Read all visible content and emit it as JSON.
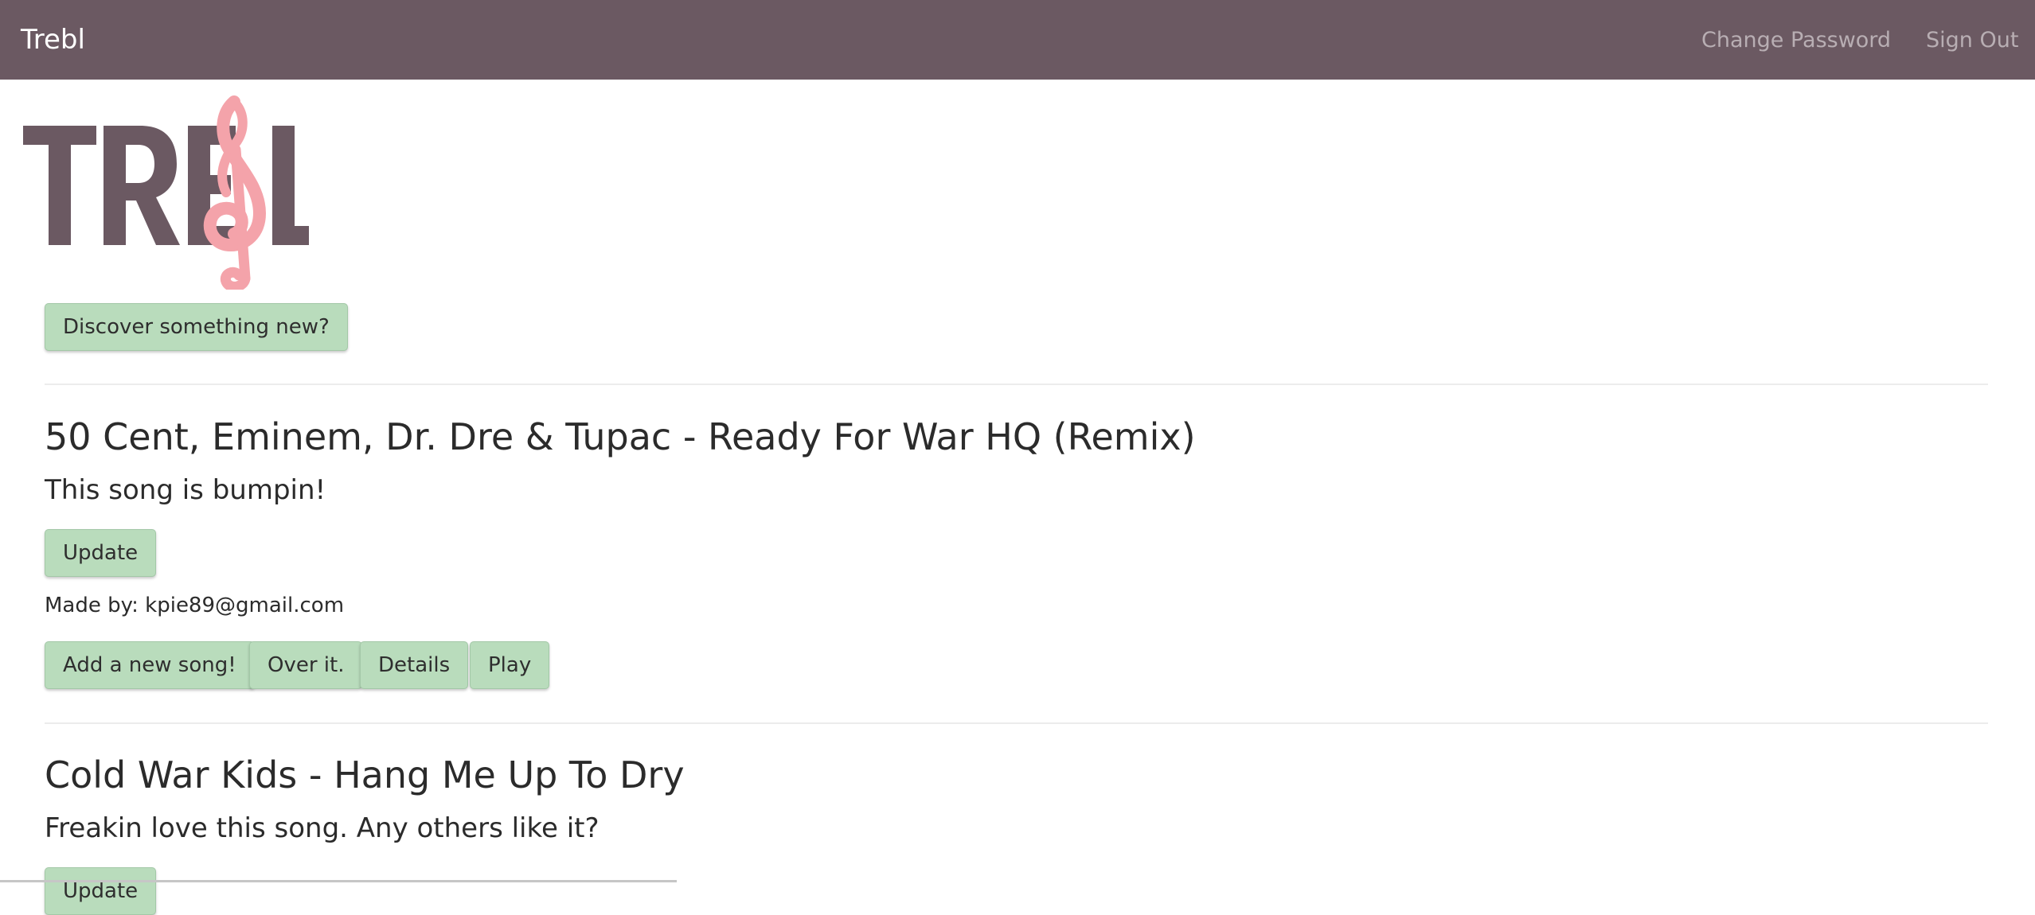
{
  "navbar": {
    "brand": "Trebl",
    "links": [
      "Change Password",
      "Sign Out"
    ]
  },
  "logo": {
    "text": "TREBL",
    "accent_color": "#f4a3aa",
    "text_color": "#6b5962"
  },
  "discover_button": "Discover something new?",
  "songs": [
    {
      "title": "50 Cent, Eminem, Dr. Dre & Tupac - Ready For War HQ (Remix)",
      "comment": "This song is bumpin!",
      "update_label": "Update",
      "made_by": "Made by: kpie89@gmail.com",
      "actions": [
        "Add a new song!",
        "Over it.",
        "Details",
        "Play"
      ]
    },
    {
      "title": "Cold War Kids - Hang Me Up To Dry",
      "comment": "Freakin love this song. Any others like it?",
      "update_label": "Update"
    }
  ],
  "colors": {
    "navbar_bg": "#6b5962",
    "button_bg": "#b9dcbc",
    "nav_link": "#b8aeb3"
  }
}
